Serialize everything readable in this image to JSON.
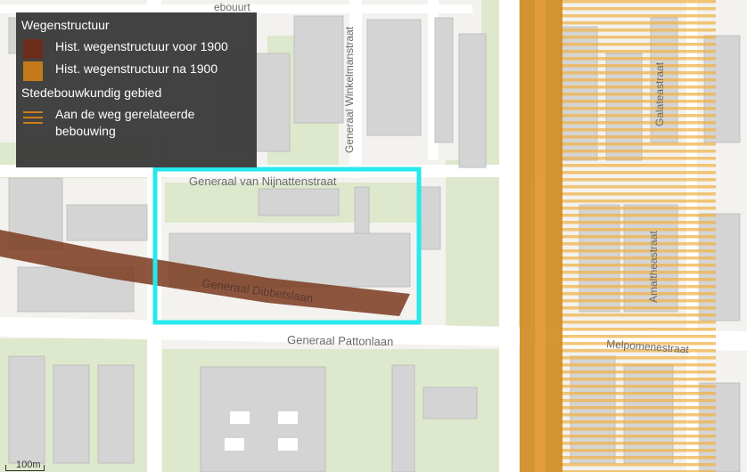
{
  "map": {
    "streets": {
      "van_nijnatten": "Generaal van Nijnattenstraat",
      "dibbets": "Generaal Dibbetslaan",
      "patton": "Generaal Pattonlaan",
      "winkelman": "Generaal Winkelmanstraat",
      "galatea": "Galateastraat",
      "amalthea": "Amaltheastraat",
      "melpomene": "Melpomenestraat",
      "partial_top_left": "ebouurt"
    },
    "colors": {
      "road_pre_1900": "#7a3a1e",
      "road_post_1900": "#cf8a1e",
      "hatch": "#f0b34a",
      "highlight": "#27e8ec",
      "building": "#d6d6d6",
      "green": "#d9e7c6"
    }
  },
  "legend": {
    "title": "Wegenstructuur",
    "items": [
      {
        "label": "Hist. wegenstructuur voor 1900",
        "color": "#6b2c1c"
      },
      {
        "label": "Hist. wegenstructuur na 1900",
        "color": "#c47a1a"
      }
    ],
    "section2_title": "Stedebouwkundig gebied",
    "items2": [
      {
        "label": "Aan de weg gerelateerde bebouwing",
        "color": "#c47a1a",
        "icon": "hatch-lines-icon"
      }
    ]
  },
  "scale": {
    "label": "100m"
  }
}
